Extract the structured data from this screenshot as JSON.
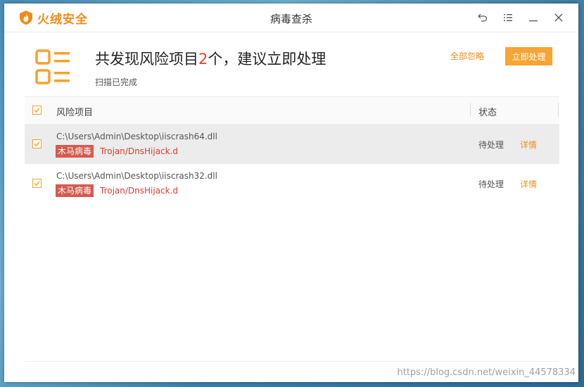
{
  "app": {
    "brand": "火绒安全",
    "window_title": "病毒查杀",
    "brand_color": "#f08c1b"
  },
  "controls": {
    "back_icon": "undo-icon",
    "menu_icon": "list-menu-icon",
    "minimize_icon": "minimize-icon",
    "close_icon": "close-icon"
  },
  "summary": {
    "headline_prefix": "共发现风险项目",
    "headline_count": "2",
    "headline_suffix": "个，建议立即处理",
    "subline": "扫描已完成",
    "ignore_all_label": "全部忽略",
    "handle_now_label": "立即处理"
  },
  "table": {
    "columns": {
      "name": "风险项目",
      "status": "状态"
    },
    "rows": [
      {
        "path": "C:\\Users\\Admin\\Desktop\\iiscrash64.dll",
        "tag": "木马病毒",
        "virus": "Trojan/DnsHijack.d",
        "status": "待处理",
        "detail": "详情"
      },
      {
        "path": "C:\\Users\\Admin\\Desktop\\iiscrash32.dll",
        "tag": "木马病毒",
        "virus": "Trojan/DnsHijack.d",
        "status": "待处理",
        "detail": "详情"
      }
    ]
  },
  "watermark": "https://blog.csdn.net/weixin_44578334"
}
